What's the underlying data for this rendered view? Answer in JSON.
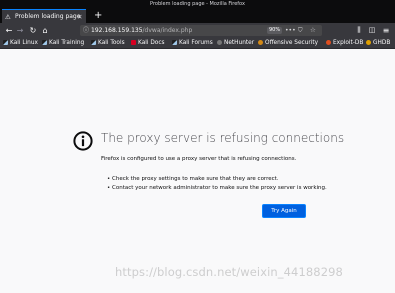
{
  "window": {
    "title": "Problem loading page - Mozilla Firefox"
  },
  "tabs": [
    {
      "label": "Problem loading page",
      "icon": "warning-icon",
      "active": true
    }
  ],
  "navigation": {
    "url_host": "192.168.159.135",
    "url_path": "/dvwa/index.php",
    "zoom": "90%"
  },
  "bookmarks": [
    {
      "label": "Kali Linux",
      "icon": "kali-icon"
    },
    {
      "label": "Kali Training",
      "icon": "kali-icon"
    },
    {
      "label": "Kali Tools",
      "icon": "kali-icon"
    },
    {
      "label": "Kali Docs",
      "icon": "kali-docs-icon"
    },
    {
      "label": "Kali Forums",
      "icon": "kali-icon"
    },
    {
      "label": "NetHunter",
      "icon": "nethunter-icon"
    },
    {
      "label": "Offensive Security",
      "icon": "offsec-icon"
    },
    {
      "label": "Exploit-DB",
      "icon": "exploit-db-icon"
    },
    {
      "label": "GHDB",
      "icon": "ghdb-icon"
    }
  ],
  "error": {
    "title": "The proxy server is refusing connections",
    "description": "Firefox is configured to use a proxy server that is refusing connections.",
    "suggestions": [
      "Check the proxy settings to make sure that they are correct.",
      "Contact your network administrator to make sure the proxy server is working."
    ],
    "button_label": "Try Again"
  },
  "watermark": "https://blog.csdn.net/weixin_44188298",
  "colors": {
    "accent": "#0a84ff",
    "button": "#0060df",
    "toolbar": "#38383d",
    "titlebar": "#0c0c0d",
    "page": "#f9f9fa"
  }
}
